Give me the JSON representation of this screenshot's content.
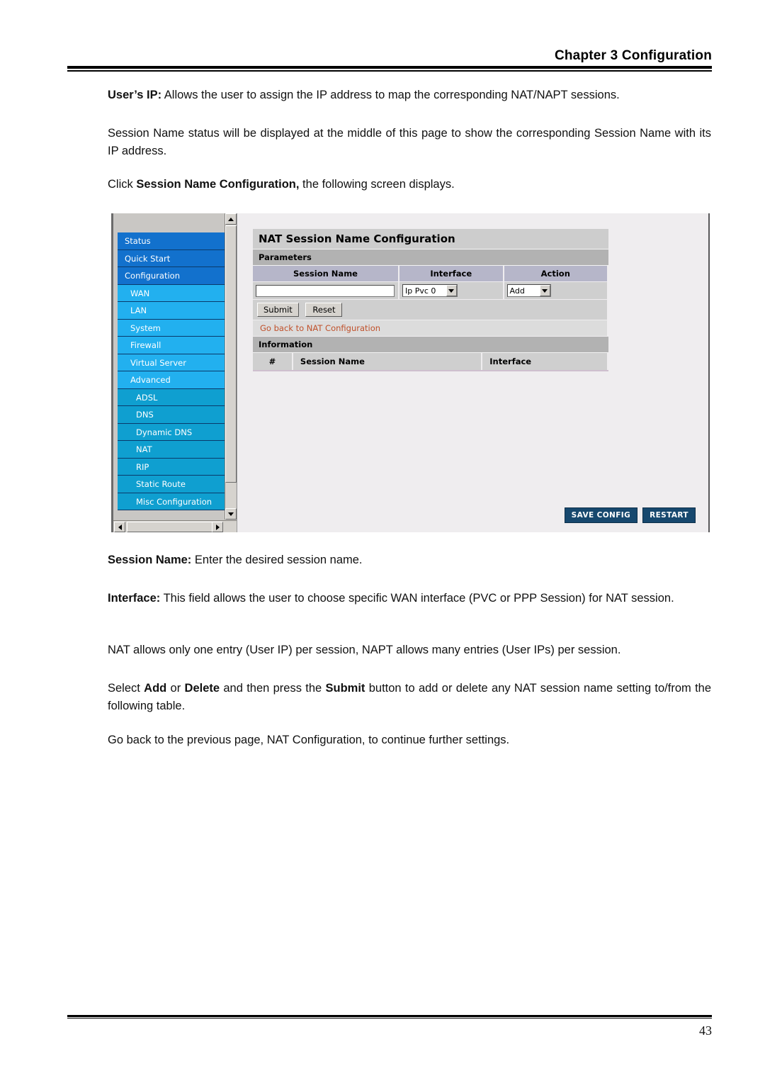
{
  "header": {
    "chapter_title": "Chapter 3 Configuration"
  },
  "body": {
    "p_usersip_bold": "User’s IP:",
    "p_usersip_rest": " Allows the user to assign the IP address to map the corresponding NAT/NAPT sessions.",
    "p_session_status": "Session Name status will be displayed at the middle of this page to show the corresponding Session Name with its IP address.",
    "p_click_pre": "Click ",
    "p_click_bold": "Session Name Configuration,",
    "p_click_post": " the following screen displays.",
    "p_sessname_bold": "Session Name:",
    "p_sessname_rest": " Enter the desired session name.",
    "p_interface_bold": "Interface:",
    "p_interface_rest": " This field allows the user to choose specific WAN interface (PVC or PPP Session) for NAT session.",
    "p_nat_allows": "NAT allows only one entry (User IP) per session, NAPT allows many entries (User IPs) per session.",
    "p_select_pre": "Select ",
    "p_select_add": "Add",
    "p_select_or": " or ",
    "p_select_delete": "Delete",
    "p_select_mid": " and then press the ",
    "p_select_submit": "Submit",
    "p_select_post": " button to add or delete any NAT session name setting to/from the following table.",
    "p_goback": "Go back to the previous page, NAT Configuration, to continue further settings."
  },
  "screenshot": {
    "sidebar": {
      "items": [
        {
          "label": "Status",
          "level": 1
        },
        {
          "label": "Quick Start",
          "level": 1
        },
        {
          "label": "Configuration",
          "level": 1
        },
        {
          "label": "WAN",
          "level": 2
        },
        {
          "label": "LAN",
          "level": 2
        },
        {
          "label": "System",
          "level": 2
        },
        {
          "label": "Firewall",
          "level": 2
        },
        {
          "label": "Virtual Server",
          "level": 2
        },
        {
          "label": "Advanced",
          "level": 2
        },
        {
          "label": "ADSL",
          "level": 3
        },
        {
          "label": "DNS",
          "level": 3
        },
        {
          "label": "Dynamic DNS",
          "level": 3
        },
        {
          "label": "NAT",
          "level": 3
        },
        {
          "label": "RIP",
          "level": 3
        },
        {
          "label": "Static Route",
          "level": 3
        },
        {
          "label": "Misc Configuration",
          "level": 3
        }
      ]
    },
    "panel": {
      "title": "NAT Session Name Configuration",
      "parameters_label": "Parameters",
      "columns": {
        "session_name": "Session Name",
        "interface": "Interface",
        "action": "Action"
      },
      "session_name_value": "",
      "interface_value": "Ip Pvc 0",
      "action_value": "Add",
      "submit_label": "Submit",
      "reset_label": "Reset",
      "goback_link": "Go back to NAT Configuration",
      "information_label": "Information",
      "info_columns": {
        "hash": "#",
        "session_name": "Session Name",
        "interface": "Interface"
      },
      "info_rows": []
    },
    "bottom_buttons": {
      "save_config": "SAVE CONFIG",
      "restart": "RESTART"
    },
    "colors": {
      "nav_level1": "#1271cd",
      "nav_level2": "#22b0ef",
      "nav_level3": "#0f9fd0",
      "link": "#c0512b",
      "navy_button": "#17486e"
    }
  },
  "footer": {
    "page_number": "43"
  }
}
